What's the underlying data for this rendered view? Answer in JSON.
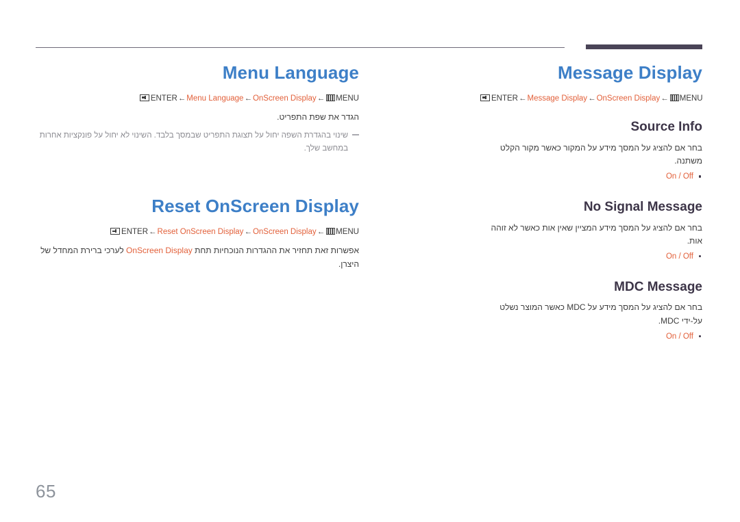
{
  "page": {
    "number": "65"
  },
  "icons": {
    "menu": "menu-icon",
    "enter": "enter-icon"
  },
  "left_column": {
    "sections": [
      {
        "title": "Menu Language",
        "path": {
          "menu_label": "MENU",
          "arrow": "←",
          "crumb1": "OnScreen Display",
          "crumb2": "Menu Language",
          "enter_label": "ENTER"
        },
        "description": "הגדר את שפת התפריט.",
        "note": "שינוי בהגדרת השפה יחול על תצוגת התפריט שבמסך בלבד. השינוי לא יחול על פונקציות אחרות במחשב שלך."
      },
      {
        "title": "Reset OnScreen Display",
        "path": {
          "menu_label": "MENU",
          "arrow": "←",
          "crumb1": "OnScreen Display",
          "crumb2": "Reset OnScreen Display",
          "enter_label": "ENTER"
        },
        "description_before": "אפשרות זאת תחזיר את ההגדרות הנוכחיות תחת ",
        "description_highlight": "OnScreen Display",
        "description_after": " לערכי ברירת המחדל של היצרן."
      }
    ]
  },
  "right_column": {
    "title": "Message Display",
    "path": {
      "menu_label": "MENU",
      "arrow": "←",
      "crumb1": "OnScreen Display",
      "crumb2": "Message Display",
      "enter_label": "ENTER"
    },
    "blocks": [
      {
        "title": "Source Info",
        "description": "בחר אם להציג על המסך מידע על המקור כאשר מקור הקלט משתנה.",
        "options": [
          "On / Off"
        ]
      },
      {
        "title": "No Signal Message",
        "description": "בחר אם להציג על המסך מידע המציין שאין אות כאשר לא זוהה אות.",
        "options": [
          "On / Off"
        ]
      },
      {
        "title": "MDC Message",
        "description": "בחר אם להציג על המסך מידע על MDC כאשר המוצר נשלט על-ידי MDC.",
        "options": [
          "On / Off"
        ]
      }
    ]
  },
  "colors": {
    "heading_blue": "#3d7fc7",
    "heading_dark": "#3d3548",
    "highlight_orange": "#e2603a",
    "body_text": "#3c3c3c",
    "note_text": "#8b8b91",
    "rule_dark": "#4a4457",
    "page_number": "#8e949c"
  }
}
